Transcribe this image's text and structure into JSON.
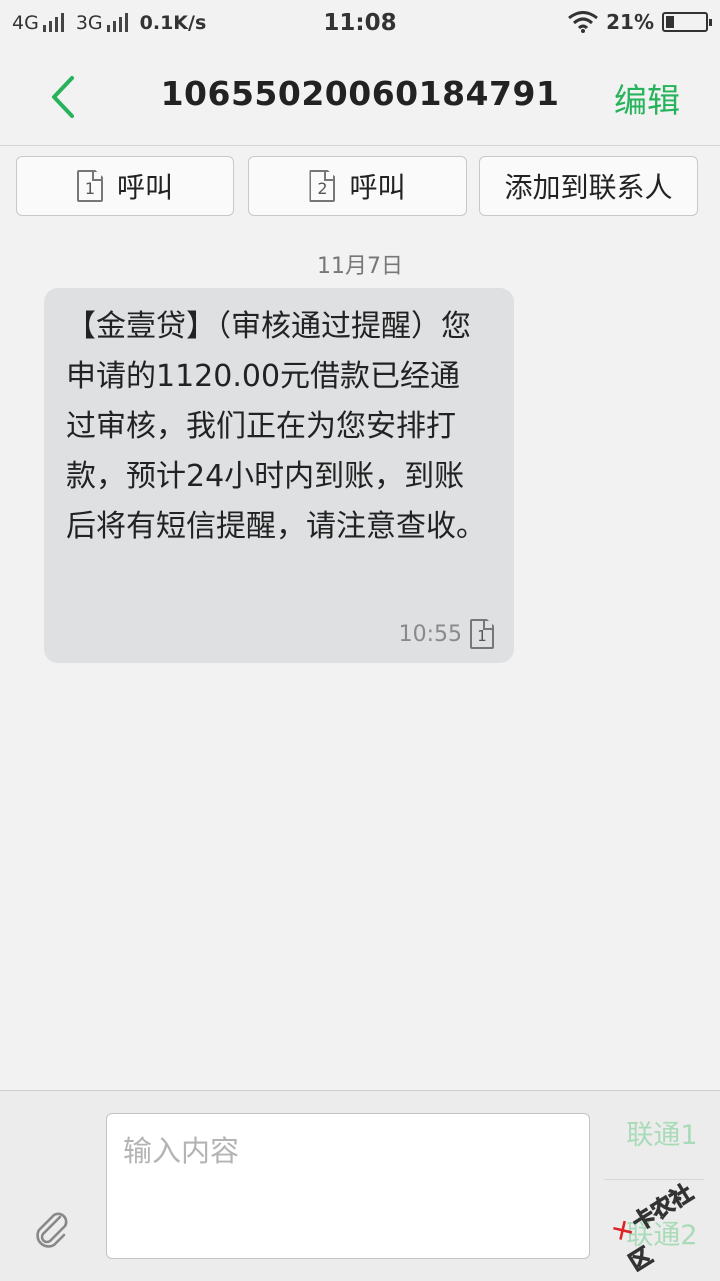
{
  "status_bar": {
    "network1": "4G",
    "network2": "3G",
    "speed": "0.1K/s",
    "time": "11:08",
    "battery_percent": "21%",
    "battery_level": 0.21
  },
  "header": {
    "title": "10655020060184791",
    "edit_label": "编辑"
  },
  "actions": [
    {
      "sim": "1",
      "label": "呼叫"
    },
    {
      "sim": "2",
      "label": "呼叫"
    },
    {
      "label": "添加到联系人"
    }
  ],
  "conversation": {
    "date": "11月7日",
    "messages": [
      {
        "text": "【金壹贷】（审核通过提醒）您申请的1120.00元借款已经通过审核，我们正在为您安排打款，预计24小时内到账，到账后将有短信提醒，请注意查收。",
        "time": "10:55",
        "sim": "1"
      }
    ]
  },
  "compose": {
    "placeholder": "输入内容",
    "send1_label": "联通1",
    "send2_label": "联通2"
  },
  "watermark": {
    "text": "卡农社区"
  },
  "colors": {
    "accent": "#27b35c",
    "bubble": "#dfe0e2",
    "send_disabled": "#a9dbb9"
  }
}
